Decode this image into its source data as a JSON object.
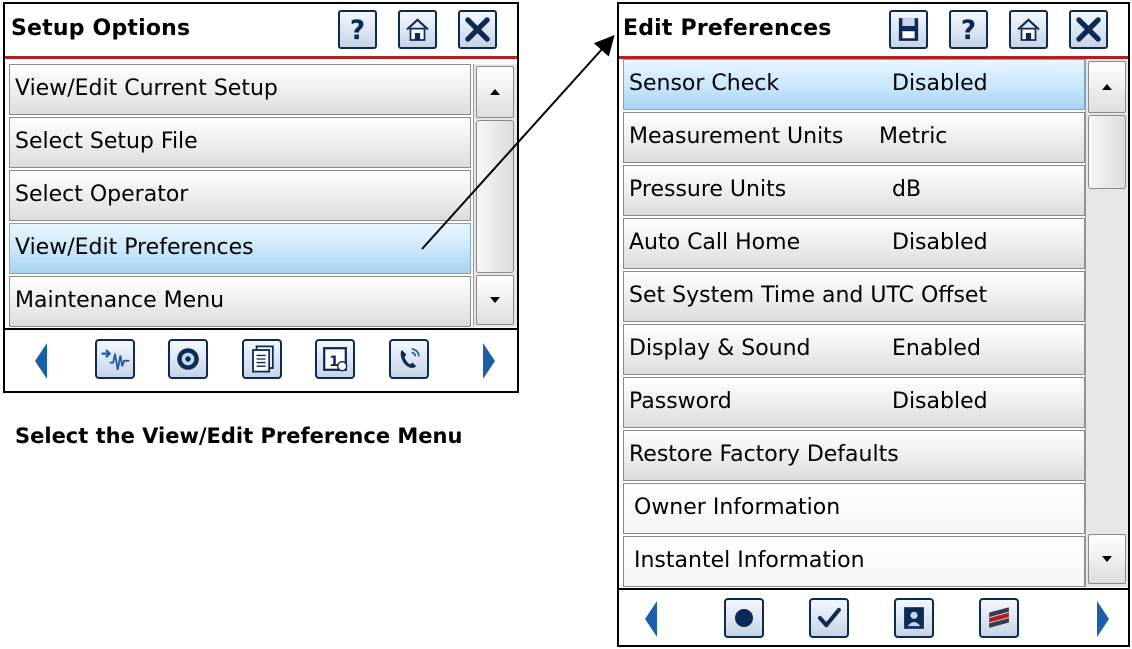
{
  "left_window": {
    "title": "Setup Options",
    "toolbar": [
      "help-icon",
      "home-icon",
      "close-icon"
    ],
    "menu_items": [
      {
        "label": "View/Edit Current Setup",
        "selected": false
      },
      {
        "label": "Select Setup File",
        "selected": false
      },
      {
        "label": "Select Operator",
        "selected": false
      },
      {
        "label": "View/Edit Preferences",
        "selected": true
      },
      {
        "label": "Maintenance Menu",
        "selected": false
      }
    ],
    "bottom_icons": [
      "waveform-icon",
      "settings-badge-icon",
      "documents-icon",
      "calendar-icon",
      "phone-icon"
    ]
  },
  "caption": "Select the View/Edit Preference Menu",
  "right_window": {
    "title": "Edit Preferences",
    "toolbar": [
      "save-icon",
      "help-icon",
      "home-icon",
      "close-icon"
    ],
    "menu_items": [
      {
        "label": "Sensor Check",
        "value": "Disabled",
        "selected": true
      },
      {
        "label": "Measurement Units",
        "value": "Metric",
        "selected": false
      },
      {
        "label": "Pressure Units",
        "value": "dB",
        "selected": false
      },
      {
        "label": "Auto Call Home",
        "value": "Disabled",
        "selected": false
      },
      {
        "label": "Set System Time and UTC Offset",
        "value": "",
        "selected": false
      },
      {
        "label": "Display & Sound",
        "value": "Enabled",
        "selected": false
      },
      {
        "label": "Password",
        "value": "Disabled",
        "selected": false
      },
      {
        "label": "Restore Factory Defaults",
        "value": "",
        "selected": false
      },
      {
        "label": "Owner Information",
        "value": "",
        "selected": false
      },
      {
        "label": "Instantel Information",
        "value": "",
        "selected": false
      }
    ],
    "bottom_icons": [
      "record-icon",
      "checkmark-icon",
      "contact-card-icon",
      "flag-icon"
    ]
  },
  "colors": {
    "accent_blue": "#1b5fa8",
    "selected_row": "#c8e6fb",
    "title_underline": "#b02020",
    "icon_border": "#0b2a55"
  }
}
